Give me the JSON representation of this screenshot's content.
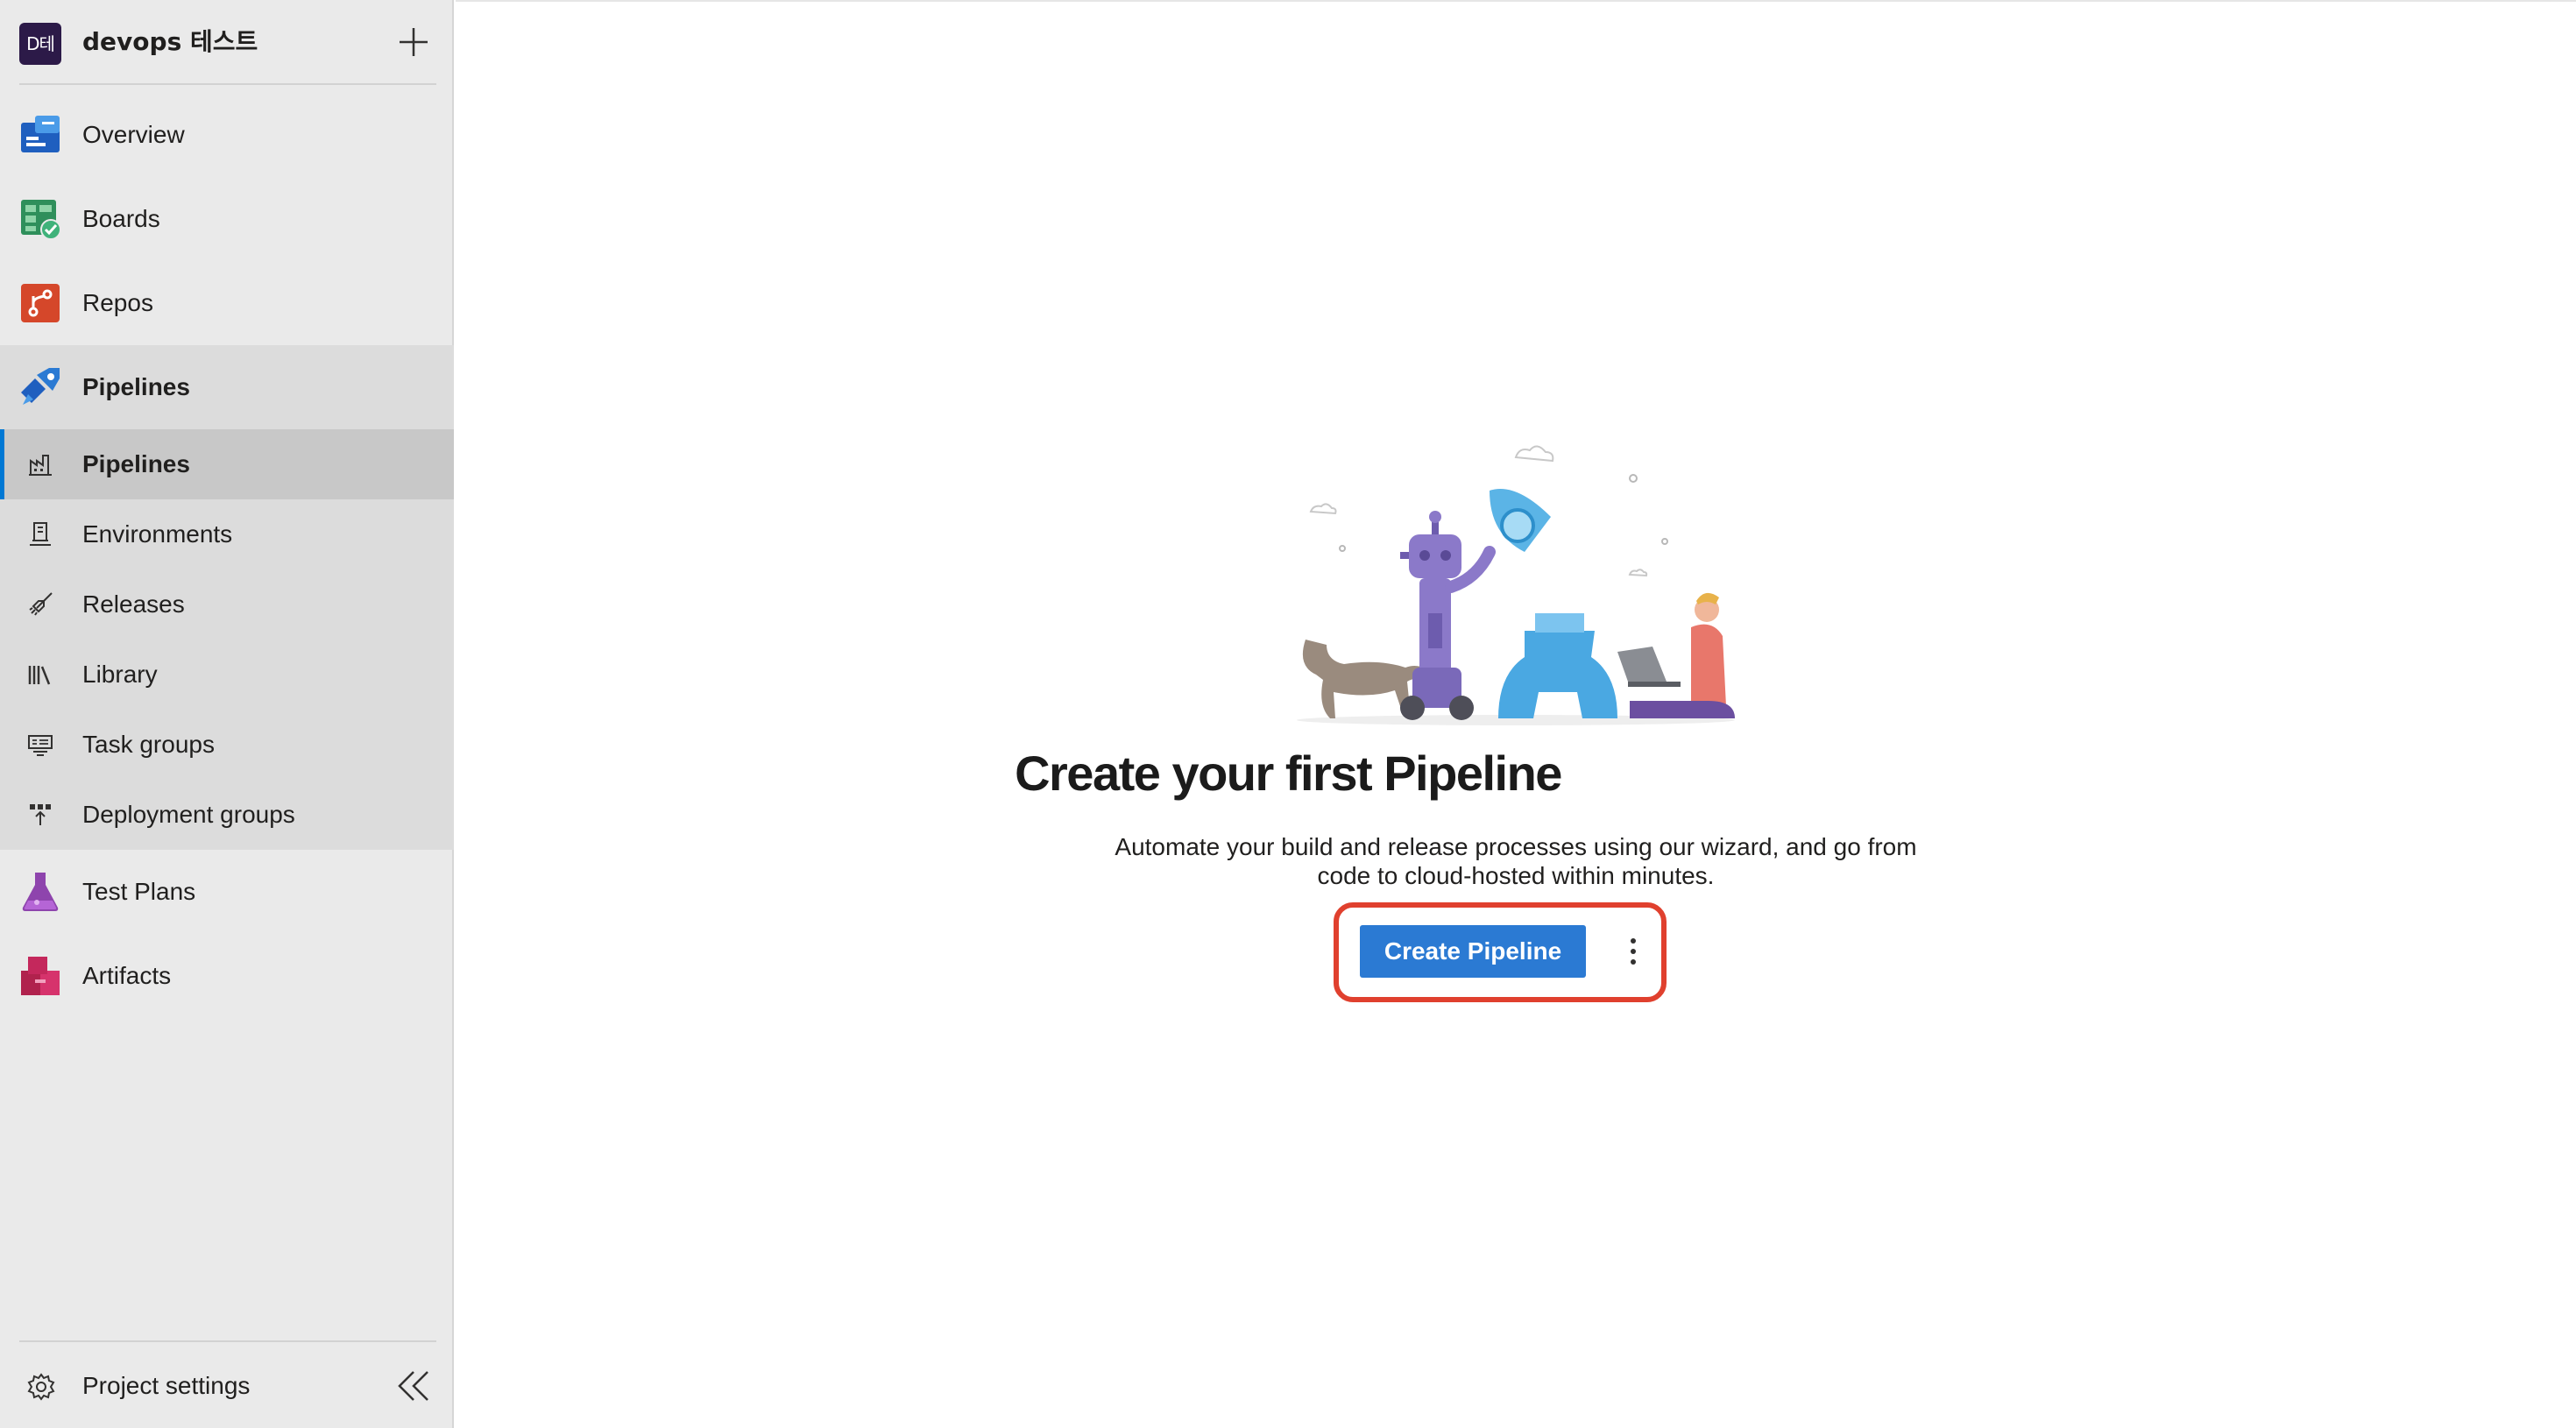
{
  "project": {
    "avatar_text": "D테",
    "name": "devops 테스트"
  },
  "nav": {
    "overview": "Overview",
    "boards": "Boards",
    "repos": "Repos",
    "pipelines": "Pipelines",
    "test_plans": "Test Plans",
    "artifacts": "Artifacts"
  },
  "pipelines_sub": {
    "pipelines": "Pipelines",
    "environments": "Environments",
    "releases": "Releases",
    "library": "Library",
    "task_groups": "Task groups",
    "deployment_groups": "Deployment groups"
  },
  "footer": {
    "project_settings": "Project settings"
  },
  "empty_state": {
    "title": "Create your first Pipeline",
    "description": "Automate your build and release processes using our wizard, and go from code to cloud-hosted within minutes.",
    "create_button": "Create Pipeline"
  },
  "colors": {
    "accent": "#2b7ad3",
    "highlight": "#e0402e",
    "selected_bar": "#0078d4"
  }
}
